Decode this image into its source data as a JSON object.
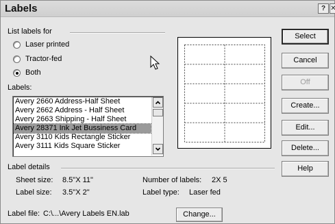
{
  "window": {
    "title": "Labels",
    "help_glyph": "?",
    "close_glyph": "✕"
  },
  "list_for": {
    "heading": "List labels for",
    "options": [
      {
        "label": "Laser printed",
        "selected": false
      },
      {
        "label": "Tractor-fed",
        "selected": false
      },
      {
        "label": "Both",
        "selected": true
      }
    ]
  },
  "labels_list": {
    "heading": "Labels:",
    "items": [
      "Avery 2660 Address-Half Sheet",
      "Avery 2662 Address - Half Sheet",
      "Avery 2663 Shipping - Half Sheet",
      "Avery 28371 Ink Jet Bussiness Card",
      "Avery 3110 Kids Rectangle Sticker",
      "Avery 3111 Kids Square Sticker"
    ],
    "selected_index": 3
  },
  "details": {
    "heading": "Label details",
    "sheet_size_label": "Sheet size:",
    "sheet_size_value": "8.5\"X 11\"",
    "label_size_label": "Label size:",
    "label_size_value": "3.5\"X 2\"",
    "num_labels_label": "Number of labels:",
    "num_labels_value": "2X 5",
    "label_type_label": "Label type:",
    "label_type_value": "Laser fed",
    "file_label": "Label file:",
    "file_value": "C:\\...\\Avery Labels EN.lab"
  },
  "buttons": {
    "select": "Select",
    "cancel": "Cancel",
    "off": "Off",
    "create": "Create...",
    "edit": "Edit...",
    "delete": "Delete...",
    "help": "Help",
    "change": "Change..."
  },
  "preview": {
    "columns": 2,
    "rows": 5
  }
}
